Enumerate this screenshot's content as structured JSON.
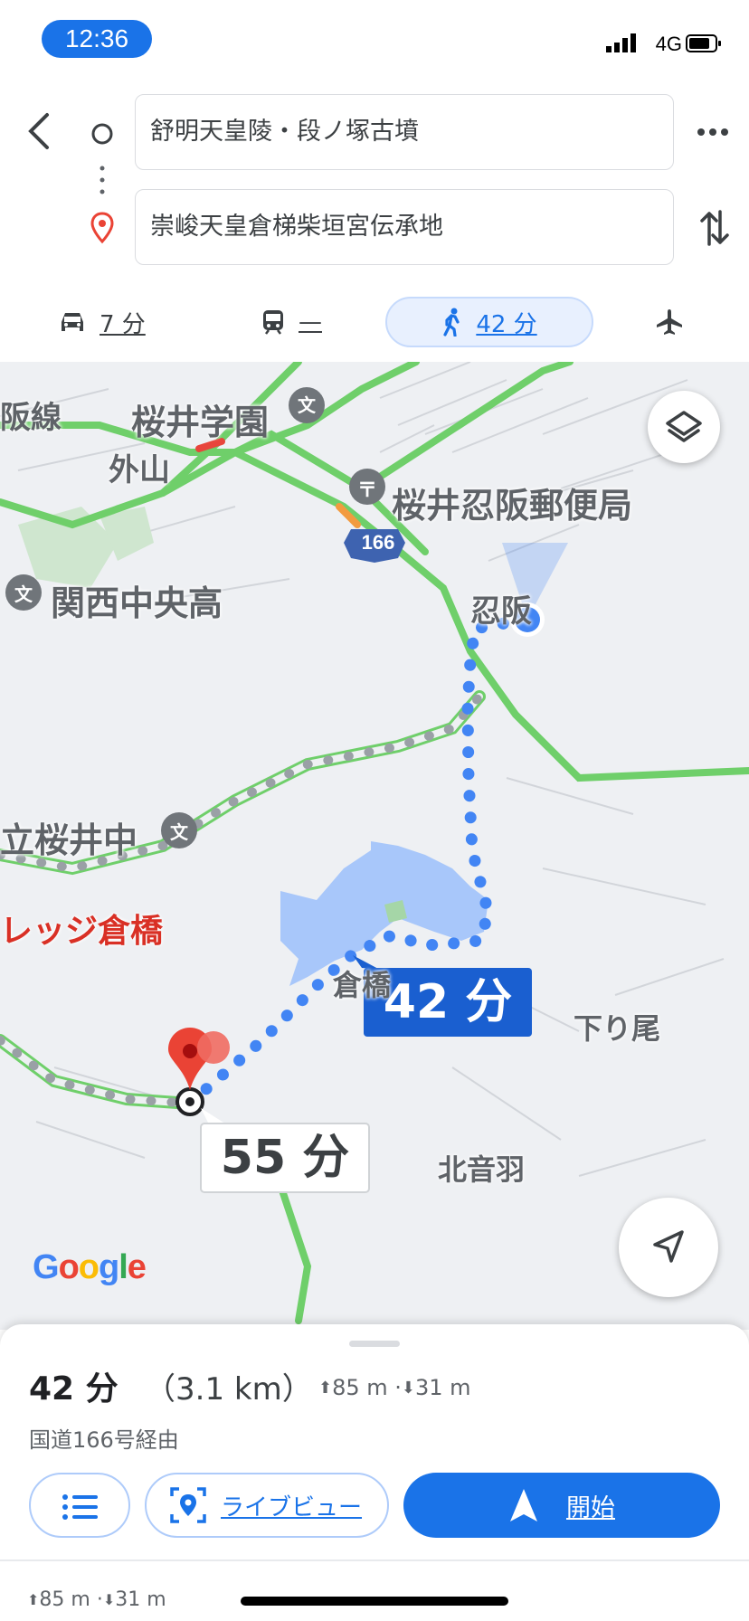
{
  "status": {
    "time": "12:36",
    "network": "4G"
  },
  "directions": {
    "origin": "舒明天皇陵・段ノ塚古墳",
    "destination": "崇峻天皇倉梯柴垣宮伝承地"
  },
  "modes": [
    {
      "icon": "car-icon",
      "label": "7 分"
    },
    {
      "icon": "train-icon",
      "label": "—"
    },
    {
      "icon": "walk-icon",
      "label": "42 分",
      "selected": true
    },
    {
      "icon": "plane-icon",
      "label": ""
    }
  ],
  "map": {
    "labels": {
      "hansen": "阪線",
      "sakurai_gakuen": "桜井学園",
      "toyama": "外山",
      "post_office": "桜井忍阪郵便局",
      "route_number": "166",
      "kansai_chuo": "関西中央高",
      "osaka": "忍阪",
      "sakurai_chu": "立桜井中",
      "kurahashi": "倉橋",
      "shimorio": "下り尾",
      "village": "レッジ倉橋",
      "kitaotowa": "北音羽"
    },
    "route_badge_main": "42 分",
    "route_badge_alt": "55 分",
    "watermark": "Google"
  },
  "summary": {
    "duration": "42 分",
    "distance": "（3.1 km）",
    "elevation": "85 m · ",
    "elevation_down": "31 m",
    "via": "国道166号経由",
    "liveview_label": "ライブビュー",
    "start_label": "開始",
    "footer_elevation": "85 m · ",
    "footer_elevation_down": "31 m"
  },
  "colors": {
    "accent": "#1a73e8",
    "route_dot": "#4285f4",
    "road_green": "#6fcf6a",
    "water": "#a8c7fa",
    "pin": "#ea4335"
  }
}
